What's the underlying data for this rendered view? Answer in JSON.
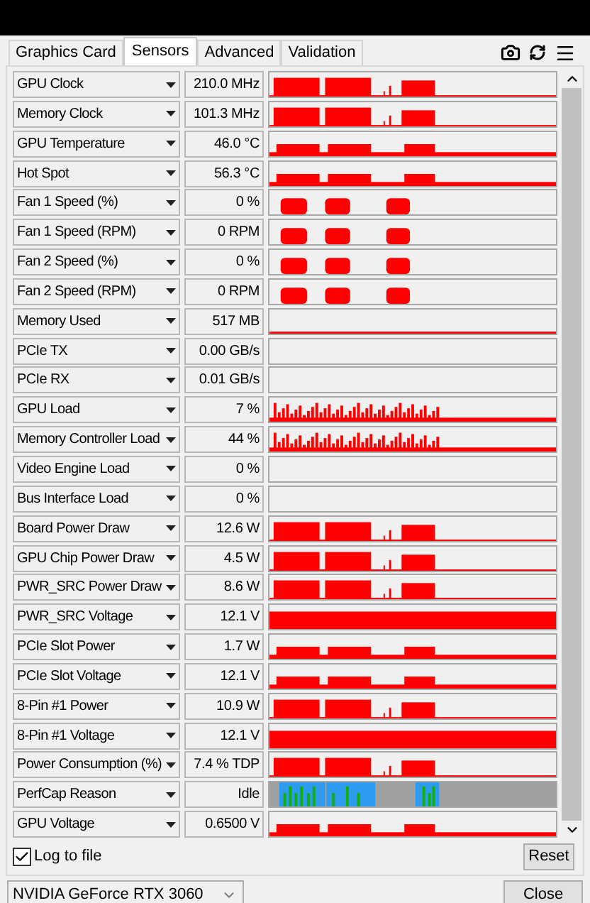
{
  "tabs": [
    {
      "label": "Graphics Card",
      "selected": false
    },
    {
      "label": "Sensors",
      "selected": true
    },
    {
      "label": "Advanced",
      "selected": false
    },
    {
      "label": "Validation",
      "selected": false
    }
  ],
  "sensors": [
    {
      "name": "GPU Clock",
      "value": "210.0 MHz",
      "kind": "bursts"
    },
    {
      "name": "Memory Clock",
      "value": "101.3 MHz",
      "kind": "bursts"
    },
    {
      "name": "GPU Temperature",
      "value": "46.0 °C",
      "kind": "plateau"
    },
    {
      "name": "Hot Spot",
      "value": "56.3 °C",
      "kind": "plateau"
    },
    {
      "name": "Fan 1 Speed (%)",
      "value": "0 %",
      "kind": "fan"
    },
    {
      "name": "Fan 1 Speed (RPM)",
      "value": "0 RPM",
      "kind": "fan"
    },
    {
      "name": "Fan 2 Speed (%)",
      "value": "0 %",
      "kind": "fan"
    },
    {
      "name": "Fan 2 Speed (RPM)",
      "value": "0 RPM",
      "kind": "fan"
    },
    {
      "name": "Memory Used",
      "value": "517 MB",
      "kind": "line"
    },
    {
      "name": "PCIe TX",
      "value": "0.00 GB/s",
      "kind": "empty"
    },
    {
      "name": "PCIe RX",
      "value": "0.01 GB/s",
      "kind": "empty"
    },
    {
      "name": "GPU Load",
      "value": "7 %",
      "kind": "spiky"
    },
    {
      "name": "Memory Controller Load",
      "value": "44 %",
      "kind": "spiky"
    },
    {
      "name": "Video Engine Load",
      "value": "0 %",
      "kind": "empty"
    },
    {
      "name": "Bus Interface Load",
      "value": "0 %",
      "kind": "empty"
    },
    {
      "name": "Board Power Draw",
      "value": "12.6 W",
      "kind": "bursts"
    },
    {
      "name": "GPU Chip Power Draw",
      "value": "4.5 W",
      "kind": "bursts"
    },
    {
      "name": "PWR_SRC Power Draw",
      "value": "8.6 W",
      "kind": "bursts"
    },
    {
      "name": "PWR_SRC Voltage",
      "value": "12.1 V",
      "kind": "full"
    },
    {
      "name": "PCIe Slot Power",
      "value": "1.7 W",
      "kind": "plateau"
    },
    {
      "name": "PCIe Slot Voltage",
      "value": "12.1 V",
      "kind": "plateau"
    },
    {
      "name": "8-Pin #1 Power",
      "value": "10.9 W",
      "kind": "bursts"
    },
    {
      "name": "8-Pin #1 Voltage",
      "value": "12.1 V",
      "kind": "full"
    },
    {
      "name": "Power Consumption (%)",
      "value": "7.4 % TDP",
      "kind": "bursts"
    },
    {
      "name": "PerfCap Reason",
      "value": "Idle",
      "kind": "perfcap"
    },
    {
      "name": "GPU Voltage",
      "value": "0.6500 V",
      "kind": "plateau"
    }
  ],
  "log_to_file": {
    "label": "Log to file",
    "checked": true
  },
  "reset_button": "Reset",
  "gpu_select": "NVIDIA GeForce RTX 3060",
  "close_button": "Close"
}
